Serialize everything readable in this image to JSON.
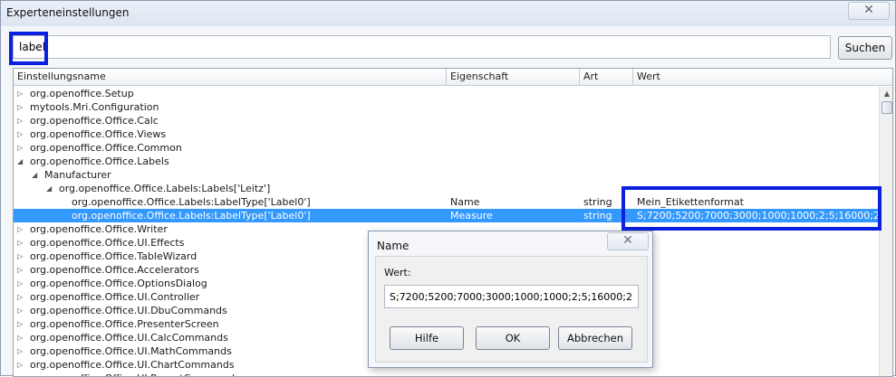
{
  "window": {
    "title": "Experteneinstellungen",
    "close_glyph": "✕"
  },
  "search": {
    "value": "label",
    "button_label": "Suchen"
  },
  "table": {
    "columns": [
      "Einstellungsname",
      "Eigenschaft",
      "Art",
      "Wert"
    ],
    "rows": [
      {
        "level": 0,
        "expander": "▷",
        "name": "org.openoffice.Setup",
        "property": "",
        "type": "",
        "value": ""
      },
      {
        "level": 0,
        "expander": "▷",
        "name": "mytools.Mri.Configuration",
        "property": "",
        "type": "",
        "value": ""
      },
      {
        "level": 0,
        "expander": "▷",
        "name": "org.openoffice.Office.Calc",
        "property": "",
        "type": "",
        "value": ""
      },
      {
        "level": 0,
        "expander": "▷",
        "name": "org.openoffice.Office.Views",
        "property": "",
        "type": "",
        "value": ""
      },
      {
        "level": 0,
        "expander": "▷",
        "name": "org.openoffice.Office.Common",
        "property": "",
        "type": "",
        "value": ""
      },
      {
        "level": 0,
        "expander": "◢",
        "name": "org.openoffice.Office.Labels",
        "property": "",
        "type": "",
        "value": ""
      },
      {
        "level": 1,
        "expander": "◢",
        "name": "Manufacturer",
        "property": "",
        "type": "",
        "value": ""
      },
      {
        "level": 2,
        "expander": "◢",
        "name": "org.openoffice.Office.Labels:Labels['Leitz']",
        "property": "",
        "type": "",
        "value": ""
      },
      {
        "level": 3,
        "expander": "",
        "name": "org.openoffice.Office.Labels:LabelType['Label0']",
        "property": "Name",
        "type": "string",
        "value": "Mein_Etikettenformat"
      },
      {
        "level": 3,
        "expander": "",
        "name": "org.openoffice.Office.Labels:LabelType['Label0']",
        "property": "Measure",
        "type": "string",
        "value": "S;7200;5200;7000;3000;1000;1000;2;5;16000;27000",
        "selected": true
      },
      {
        "level": 0,
        "expander": "▷",
        "name": "org.openoffice.Office.Writer",
        "property": "",
        "type": "",
        "value": ""
      },
      {
        "level": 0,
        "expander": "▷",
        "name": "org.openoffice.Office.UI.Effects",
        "property": "",
        "type": "",
        "value": ""
      },
      {
        "level": 0,
        "expander": "▷",
        "name": "org.openoffice.Office.TableWizard",
        "property": "",
        "type": "",
        "value": ""
      },
      {
        "level": 0,
        "expander": "▷",
        "name": "org.openoffice.Office.Accelerators",
        "property": "",
        "type": "",
        "value": ""
      },
      {
        "level": 0,
        "expander": "▷",
        "name": "org.openoffice.Office.OptionsDialog",
        "property": "",
        "type": "",
        "value": ""
      },
      {
        "level": 0,
        "expander": "▷",
        "name": "org.openoffice.Office.UI.Controller",
        "property": "",
        "type": "",
        "value": ""
      },
      {
        "level": 0,
        "expander": "▷",
        "name": "org.openoffice.Office.UI.DbuCommands",
        "property": "",
        "type": "",
        "value": ""
      },
      {
        "level": 0,
        "expander": "▷",
        "name": "org.openoffice.Office.PresenterScreen",
        "property": "",
        "type": "",
        "value": ""
      },
      {
        "level": 0,
        "expander": "▷",
        "name": "org.openoffice.Office.UI.CalcCommands",
        "property": "",
        "type": "",
        "value": ""
      },
      {
        "level": 0,
        "expander": "▷",
        "name": "org.openoffice.Office.UI.MathCommands",
        "property": "",
        "type": "",
        "value": ""
      },
      {
        "level": 0,
        "expander": "▷",
        "name": "org.openoffice.Office.UI.ChartCommands",
        "property": "",
        "type": "",
        "value": ""
      },
      {
        "level": 0,
        "expander": "▷",
        "name": "org.openoffice.Office.UI.ReportCommands",
        "property": "",
        "type": "",
        "value": ""
      }
    ]
  },
  "dialog": {
    "title": "Name",
    "close_glyph": "✕",
    "field_label": "Wert:",
    "field_value": "S;7200;5200;7000;3000;1000;1000;2;5;16000;27000",
    "help_label": "Hilfe",
    "ok_label": "OK",
    "cancel_label": "Abbrechen"
  },
  "colors": {
    "highlight_box": "#0a1fe0",
    "selection": "#3399ff"
  }
}
